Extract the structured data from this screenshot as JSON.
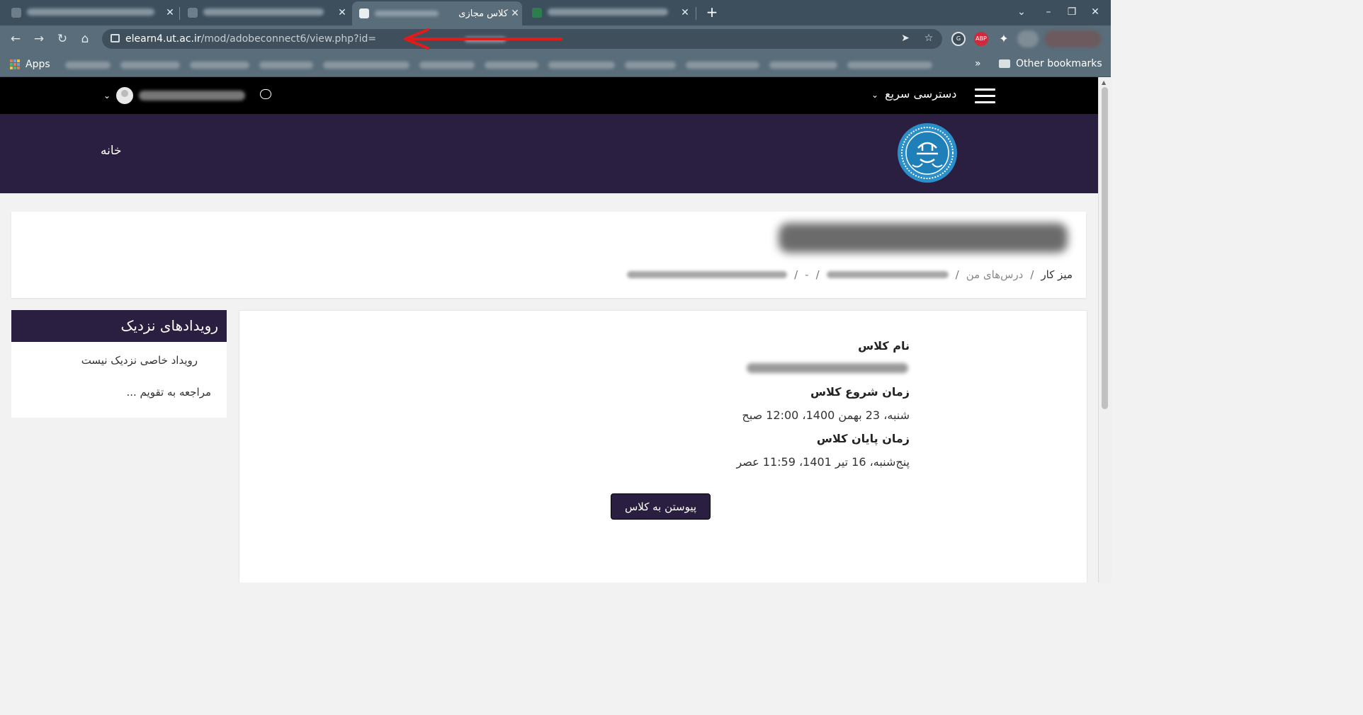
{
  "browser": {
    "tabs": [
      {
        "title": "",
        "blurred": true
      },
      {
        "title": "",
        "blurred": true
      },
      {
        "title": "کلاس مجازی",
        "active": true
      },
      {
        "title": "",
        "blurred": true
      }
    ],
    "url_host": "elearn4.ut.ac.ir",
    "url_path": "/mod/adobeconnect6/view.php?id=",
    "bookmarks_apps": "Apps",
    "bookmarks_more": "»",
    "other_bookmarks": "Other bookmarks",
    "extension_abp": "ABP"
  },
  "site": {
    "quick_access": "دسترسی سریع",
    "home": "خانه"
  },
  "breadcrumb": {
    "dashboard": "میز کار",
    "my_courses": "درس‌های من",
    "dash": "-"
  },
  "events_block": {
    "title": "رویدادهای نزدیک",
    "none": "رویداد خاصی نزدیک نیست",
    "calendar_link": "... مراجعه به تقویم"
  },
  "class_info": {
    "name_label": "نام کلاس",
    "start_label": "زمان شروع کلاس",
    "start_value": "شنبه، 23 بهمن 1400، 12:00 صبح",
    "end_label": "زمان پایان کلاس",
    "end_value": "پنج‌شنبه، 16 تیر 1401، 11:59 عصر",
    "join_button": "پیوستن به کلاس"
  },
  "colors": {
    "brand_purple": "#2a1f40",
    "annotation_arrow": "#e01b1b"
  }
}
